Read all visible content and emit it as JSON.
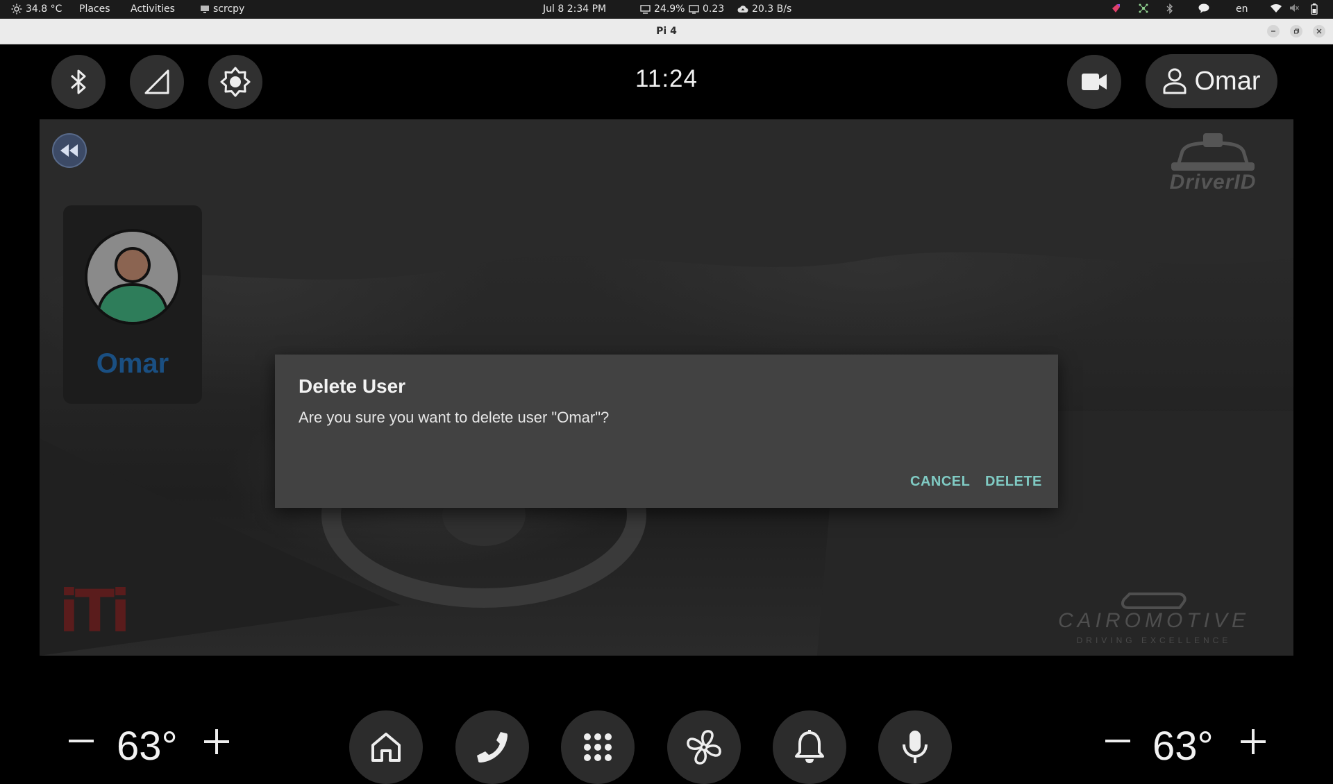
{
  "system_bar": {
    "temperature": "34.8 °C",
    "places": "Places",
    "activities": "Activities",
    "app_name": "scrcpy",
    "datetime": "Jul 8  2:34 PM",
    "cpu": "24.9%",
    "load": "0.23",
    "network": "20.3 B/s",
    "language": "en"
  },
  "window": {
    "title": "Pi 4"
  },
  "app": {
    "clock": "11:24",
    "current_user": "Omar",
    "user_card": {
      "name": "Omar"
    },
    "brand_driverid": "DriverID",
    "brand_iti": "iTi",
    "brand_cairomotive": "CAIROMOTIVE",
    "brand_cairomotive_tagline": "DRIVING EXCELLENCE"
  },
  "dialog": {
    "title": "Delete User",
    "message": "Are you sure you want to delete user \"Omar\"?",
    "cancel_label": "CANCEL",
    "delete_label": "DELETE"
  },
  "climate": {
    "left_temp": "63°",
    "right_temp": "63°",
    "minus": "−",
    "plus": "+"
  },
  "dock": {
    "items": [
      "home-icon",
      "phone-icon",
      "apps-grid-icon",
      "fan-icon",
      "notifications-icon",
      "microphone-icon"
    ]
  },
  "colors": {
    "accent_button": "#80cbc4",
    "user_name": "#1a4f82",
    "dialog_bg": "#424242"
  }
}
